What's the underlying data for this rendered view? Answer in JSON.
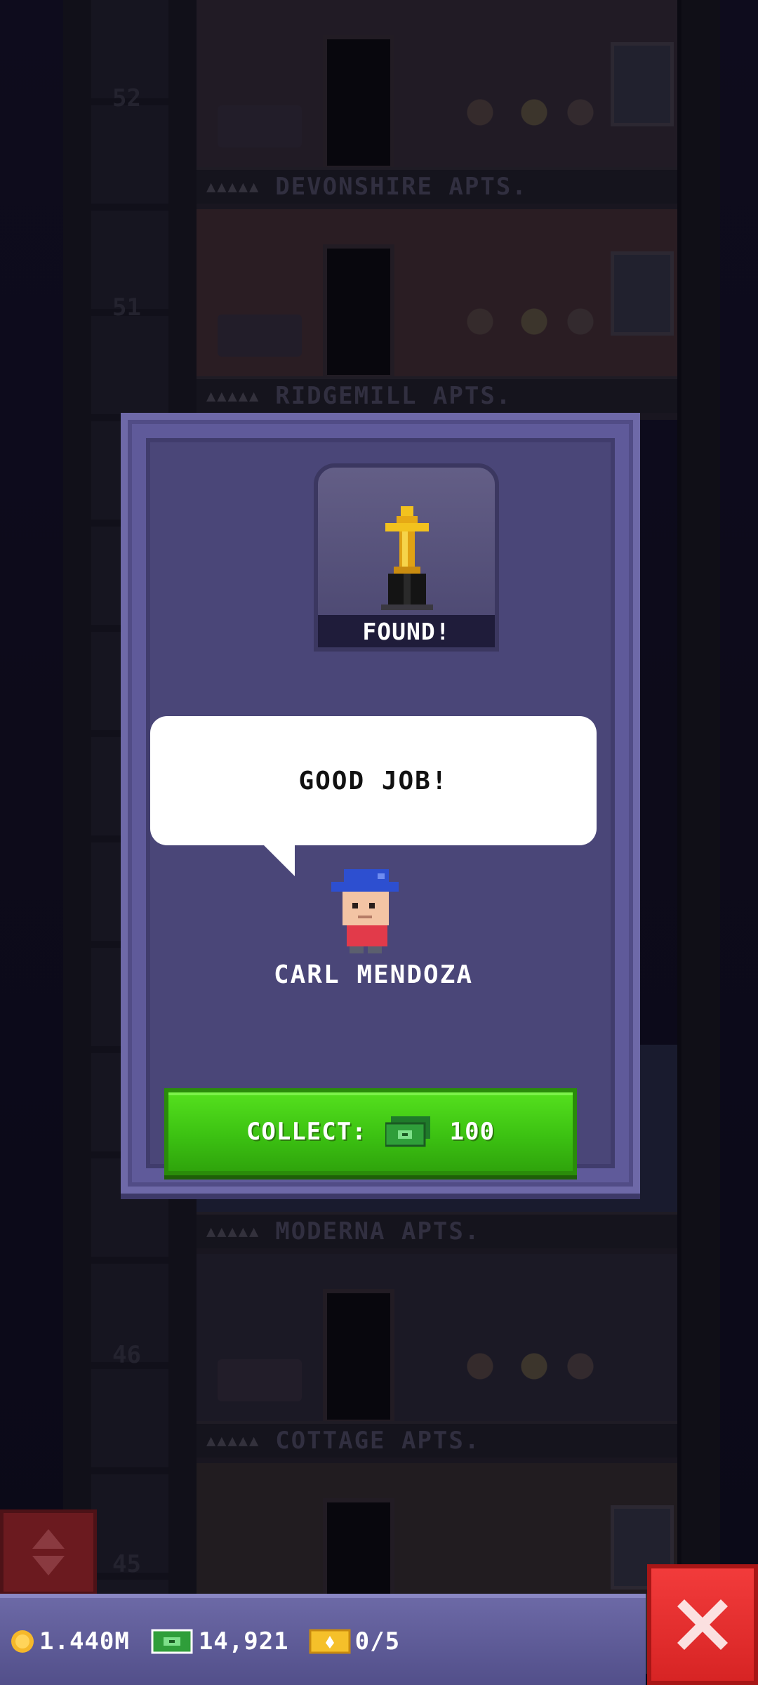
{
  "tower": {
    "floors": [
      {
        "number": "52",
        "name": "DEVONSHIRE APTS.",
        "stars": "▲▲▲▲▲",
        "room_color": "#3a2f3a"
      },
      {
        "number": "51",
        "name": "RIDGEMILL APTS.",
        "stars": "▲▲▲▲▲",
        "room_color": "#4a3236"
      },
      {
        "number": "",
        "name": "MODERNA APTS.",
        "stars": "▲▲▲▲▲",
        "room_color": "#2b2f4a"
      },
      {
        "number": "46",
        "name": "COTTAGE APTS.",
        "stars": "▲▲▲▲▲",
        "room_color": "#2f2b3a"
      },
      {
        "number": "45",
        "name": "",
        "stars": "",
        "room_color": "#3a3030"
      }
    ]
  },
  "dialog": {
    "badge_text": "FOUND!",
    "trophy_icon": "golden-trophy-icon",
    "message": "GOOD JOB!",
    "character_name": "CARL MENDOZA",
    "collect_label": "COLLECT:",
    "collect_amount": "100",
    "collect_icon": "bux-cash-icon"
  },
  "status_bar": {
    "coins": "1.440M",
    "bux": "14,921",
    "tickets": "0/5"
  },
  "colors": {
    "dialog_bg": "#4a4678",
    "collect_green": "#3cc212",
    "close_red": "#d72424",
    "bar_purple": "#6c69a6"
  }
}
